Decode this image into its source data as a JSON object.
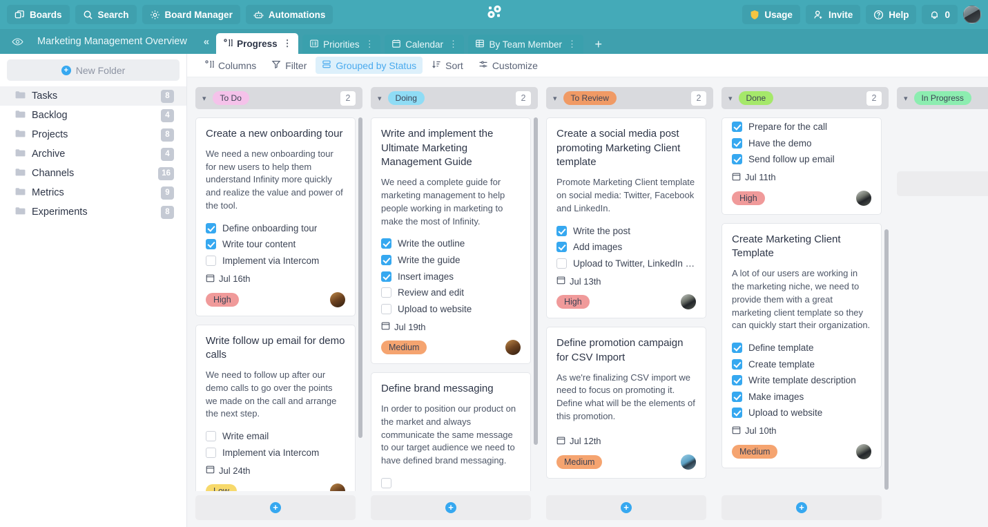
{
  "topbar": {
    "left_buttons": [
      {
        "label": "Boards",
        "icon": "boards-icon"
      },
      {
        "label": "Search",
        "icon": "search-icon"
      },
      {
        "label": "Board Manager",
        "icon": "gear-icon"
      },
      {
        "label": "Automations",
        "icon": "robot-icon"
      }
    ],
    "logo": "infinity-logo",
    "right_buttons": [
      {
        "label": "Usage",
        "icon": "shield-icon"
      },
      {
        "label": "Invite",
        "icon": "user-plus-icon"
      },
      {
        "label": "Help",
        "icon": "question-circle-icon"
      },
      {
        "label": "0",
        "icon": "bell-icon"
      }
    ],
    "avatar": "user-avatar",
    "bg_color": "#44aab8"
  },
  "tabbar": {
    "eye_icon": "eye-icon",
    "board_title": "Marketing Management Overview",
    "collapse_label": "«",
    "tabs": [
      {
        "label": "Progress",
        "icon": "columns-icon",
        "active": true,
        "menu": "⋮"
      },
      {
        "label": "Priorities",
        "icon": "list-icon",
        "active": false,
        "menu": "⋮"
      },
      {
        "label": "Calendar",
        "icon": "calendar-icon",
        "active": false,
        "menu": "⋮"
      },
      {
        "label": "By Team Member",
        "icon": "table-icon",
        "active": false,
        "menu": "⋮"
      }
    ],
    "add_tab": "+"
  },
  "sidebar": {
    "new_folder_label": "New Folder",
    "items": [
      {
        "label": "Tasks",
        "count": "8",
        "selected": true
      },
      {
        "label": "Backlog",
        "count": "4",
        "selected": false
      },
      {
        "label": "Projects",
        "count": "8",
        "selected": false
      },
      {
        "label": "Archive",
        "count": "4",
        "selected": false
      },
      {
        "label": "Channels",
        "count": "16",
        "selected": false
      },
      {
        "label": "Metrics",
        "count": "9",
        "selected": false
      },
      {
        "label": "Experiments",
        "count": "8",
        "selected": false
      }
    ]
  },
  "toolbar": {
    "items": [
      {
        "label": "Columns",
        "icon": "columns-icon",
        "active": false
      },
      {
        "label": "Filter",
        "icon": "funnel-icon",
        "active": false
      },
      {
        "label": "Grouped by Status",
        "icon": "group-icon",
        "active": true
      },
      {
        "label": "Sort",
        "icon": "sort-icon",
        "active": false
      },
      {
        "label": "Customize",
        "icon": "sliders-icon",
        "active": false
      }
    ],
    "accent_color": "#4aaaee"
  },
  "board": {
    "add_card_label": "+",
    "columns": [
      {
        "status": "To Do",
        "status_color": "#f5c2ea",
        "count": "2",
        "scroll_thumb": {
          "top_pct": 0,
          "height_pct": 86
        },
        "cards": [
          {
            "title": "Create a new onboarding tour",
            "description": "We need a new onboarding tour for new users to help them understand Infinity more quickly and realize the value and power of the tool.",
            "checklist": [
              {
                "label": "Define onboarding tour",
                "checked": true
              },
              {
                "label": "Write tour content",
                "checked": true
              },
              {
                "label": "Implement via Intercom",
                "checked": false
              }
            ],
            "date": "Jul 16th",
            "priority": "High",
            "priority_color": "#f09a9a",
            "avatar": "brown"
          },
          {
            "title": "Write follow up email for demo calls",
            "description": "We need to follow up after our demo calls to go over the points we made on the call and arrange the next step.",
            "checklist": [
              {
                "label": "Write email",
                "checked": false
              },
              {
                "label": "Implement via Intercom",
                "checked": false
              }
            ],
            "date": "Jul 24th",
            "priority": "Low",
            "priority_color": "#f7d96b",
            "avatar": "brown"
          }
        ]
      },
      {
        "status": "Doing",
        "status_color": "#8fdcf5",
        "count": "2",
        "scroll_thumb": {
          "top_pct": 0,
          "height_pct": 88
        },
        "cards": [
          {
            "title": "Write and implement the Ultimate Marketing Management Guide",
            "description": "We need a complete guide for marketing management to help people working in marketing to make the most of Infinity.",
            "checklist": [
              {
                "label": "Write the outline",
                "checked": true
              },
              {
                "label": "Write the guide",
                "checked": true
              },
              {
                "label": "Insert images",
                "checked": true
              },
              {
                "label": "Review and edit",
                "checked": false
              },
              {
                "label": "Upload to website",
                "checked": false
              }
            ],
            "date": "Jul 19th",
            "priority": "Medium",
            "priority_color": "#f5a470",
            "avatar": "brown"
          },
          {
            "title": "Define brand messaging",
            "description": "In order to position our product on the market and always communicate the same message to our target audience we need to have defined brand messaging.",
            "checklist": [],
            "date": "",
            "priority": "",
            "priority_color": "",
            "avatar": ""
          }
        ]
      },
      {
        "status": "To Review",
        "status_color": "#f09a65",
        "count": "2",
        "scroll_thumb": {
          "top_pct": 0,
          "height_pct": 100
        },
        "cards": [
          {
            "title": "Create a social media post promoting Marketing Client template",
            "description": "Promote Marketing Client template on social media: Twitter, Facebook and LinkedIn.",
            "checklist": [
              {
                "label": "Write the post",
                "checked": true
              },
              {
                "label": "Add images",
                "checked": true
              },
              {
                "label": "Upload to Twitter, LinkedIn and ...",
                "checked": false
              }
            ],
            "date": "Jul 13th",
            "priority": "High",
            "priority_color": "#f09a9a",
            "avatar": "gray"
          },
          {
            "title": "Define promotion campaign for CSV Import",
            "description": "As we're finalizing CSV import we need to focus on promoting it. Define what will be the elements of this promotion.",
            "checklist": [],
            "date": "Jul 12th",
            "priority": "Medium",
            "priority_color": "#f5a470",
            "avatar": "blue"
          }
        ]
      },
      {
        "status": "Done",
        "status_color": "#a5e86a",
        "count": "2",
        "scroll_thumb": {
          "top_pct": 30,
          "height_pct": 70
        },
        "cards": [
          {
            "title": "",
            "description": "",
            "checklist": [
              {
                "label": "Prepare for the call",
                "checked": true
              },
              {
                "label": "Have the demo",
                "checked": true
              },
              {
                "label": "Send follow up email",
                "checked": true
              }
            ],
            "date": "Jul 11th",
            "priority": "High",
            "priority_color": "#f09a9a",
            "avatar": "gray"
          },
          {
            "title": "Create Marketing Client Template",
            "description": "A lot of our users are working in the marketing niche, we need to provide them with a great marketing client template so they can quickly start their organization.",
            "checklist": [
              {
                "label": "Define template",
                "checked": true
              },
              {
                "label": "Create template",
                "checked": true
              },
              {
                "label": "Write template description",
                "checked": true
              },
              {
                "label": "Make images",
                "checked": true
              },
              {
                "label": "Upload to website",
                "checked": true
              }
            ],
            "date": "Jul 10th",
            "priority": "Medium",
            "priority_color": "#f5a470",
            "avatar": "gray"
          }
        ]
      },
      {
        "status": "In Progress",
        "status_color": "#8cedb0",
        "count": "",
        "scroll_thumb": {
          "top_pct": 0,
          "height_pct": 0
        },
        "cards": []
      }
    ]
  }
}
